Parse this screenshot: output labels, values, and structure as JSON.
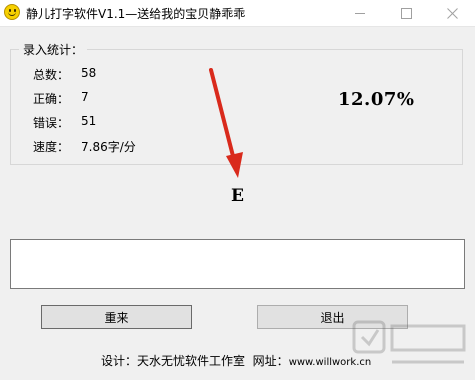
{
  "window": {
    "title": "静儿打字软件V1.1—送给我的宝贝静乖乖"
  },
  "stats": {
    "legend": "录入统计：",
    "total_label": "总数：",
    "total_value": "58",
    "correct_label": "正确：",
    "correct_value": "7",
    "error_label": "错误：",
    "error_value": "51",
    "speed_label": "速度：",
    "speed_value": "7.86字/分",
    "accuracy": "12.07%"
  },
  "practice": {
    "current_char": "E",
    "input_value": ""
  },
  "buttons": {
    "restart_label": "重来",
    "exit_label": "退出"
  },
  "footer": {
    "design_label": "设计：",
    "designer": "天水无忧软件工作室",
    "site_label": "网址：",
    "url": "www.willwork.cn"
  },
  "colors": {
    "arrow": "#d92a1c",
    "window_bg": "#f0f0f0"
  }
}
